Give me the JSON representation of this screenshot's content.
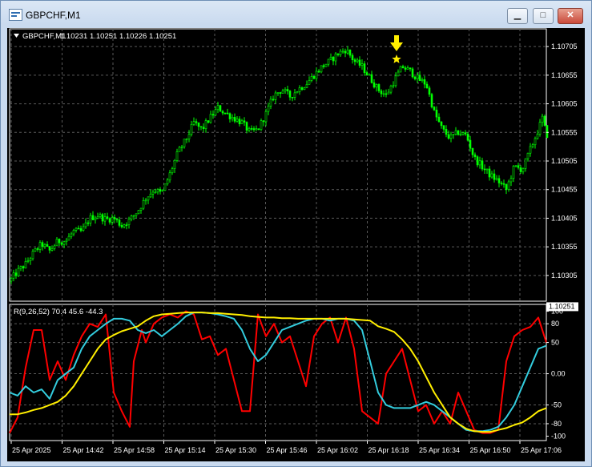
{
  "window": {
    "title": "GBPCHF,M1",
    "buttons": {
      "minimize": "▁",
      "maximize": "□",
      "close": "✕"
    }
  },
  "header": {
    "symbol": "GBPCHF,M1",
    "ohlc": "1.10231 1.10251 1.10226 1.10251",
    "menu_icon": "triangle-down-icon"
  },
  "indicator": {
    "label": "R(9,26,52) 70.4 45.6 -44.3"
  },
  "colors": {
    "background": "#000000",
    "candle": "#00ff00",
    "grid": "#5a5a5a",
    "axis_text": "#ffffff",
    "line_fast": "#ff0000",
    "line_mid": "#33ccdd",
    "line_slow": "#ffee00",
    "marker": "#ffee00"
  },
  "chart_data": [
    {
      "type": "candlestick",
      "symbol": "GBPCHF",
      "timeframe": "M1",
      "last_price": 1.10251,
      "last_price_label": "1.10251",
      "ylim": [
        1.1026,
        1.10736
      ],
      "y_ticks": [
        "1.10705",
        "1.10655",
        "1.10605",
        "1.10555",
        "1.10505",
        "1.10455",
        "1.10405",
        "1.10355",
        "1.10305"
      ],
      "x_ticks": [
        "25 Apr 2025",
        "25 Apr 14:42",
        "25 Apr 14:58",
        "25 Apr 15:14",
        "25 Apr 15:30",
        "25 Apr 15:46",
        "25 Apr 16:02",
        "25 Apr 16:18",
        "25 Apr 16:34",
        "25 Apr 16:50",
        "25 Apr 17:06"
      ],
      "close_path": [
        [
          0,
          1.10295
        ],
        [
          10,
          1.10312
        ],
        [
          20,
          1.10325
        ],
        [
          30,
          1.10345
        ],
        [
          40,
          1.1036
        ],
        [
          50,
          1.10348
        ],
        [
          60,
          1.10365
        ],
        [
          70,
          1.10365
        ],
        [
          80,
          1.10382
        ],
        [
          90,
          1.10382
        ],
        [
          100,
          1.10405
        ],
        [
          110,
          1.1041
        ],
        [
          120,
          1.10403
        ],
        [
          130,
          1.10405
        ],
        [
          140,
          1.10392
        ],
        [
          150,
          1.10402
        ],
        [
          160,
          1.10418
        ],
        [
          170,
          1.1044
        ],
        [
          180,
          1.10455
        ],
        [
          190,
          1.10448
        ],
        [
          200,
          1.10482
        ],
        [
          210,
          1.1052
        ],
        [
          220,
          1.10542
        ],
        [
          230,
          1.10572
        ],
        [
          240,
          1.1056
        ],
        [
          250,
          1.1058
        ],
        [
          260,
          1.10598
        ],
        [
          270,
          1.10588
        ],
        [
          280,
          1.1058
        ],
        [
          290,
          1.10572
        ],
        [
          300,
          1.10555
        ],
        [
          310,
          1.1056
        ],
        [
          320,
          1.10588
        ],
        [
          330,
          1.1062
        ],
        [
          340,
          1.1063
        ],
        [
          350,
          1.10618
        ],
        [
          360,
          1.1063
        ],
        [
          370,
          1.1064
        ],
        [
          380,
          1.10655
        ],
        [
          390,
          1.1067
        ],
        [
          400,
          1.1068
        ],
        [
          410,
          1.10693
        ],
        [
          420,
          1.107
        ],
        [
          430,
          1.1068
        ],
        [
          440,
          1.1067
        ],
        [
          450,
          1.1065
        ],
        [
          460,
          1.1063
        ],
        [
          470,
          1.1062
        ],
        [
          480,
          1.10645
        ],
        [
          490,
          1.1067
        ],
        [
          500,
          1.10662
        ],
        [
          510,
          1.10648
        ],
        [
          520,
          1.1064
        ],
        [
          530,
          1.1059
        ],
        [
          540,
          1.1056
        ],
        [
          550,
          1.10545
        ],
        [
          560,
          1.10555
        ],
        [
          570,
          1.1055
        ],
        [
          580,
          1.1051
        ],
        [
          590,
          1.10495
        ],
        [
          600,
          1.1048
        ],
        [
          610,
          1.1047
        ],
        [
          620,
          1.10455
        ],
        [
          630,
          1.10495
        ],
        [
          640,
          1.1049
        ],
        [
          650,
          1.10525
        ],
        [
          660,
          1.1056
        ],
        [
          665,
          1.1058
        ],
        [
          670,
          1.10551
        ]
      ],
      "annotations": [
        {
          "type": "arrow-down",
          "at": 483
        },
        {
          "type": "star",
          "at": 483
        }
      ]
    },
    {
      "type": "line",
      "name": "R(9,26,52)",
      "values_printed": [
        70.4,
        45.6,
        -44.3
      ],
      "ylim": [
        -107,
        111
      ],
      "y_ticks": [
        100,
        80,
        50,
        "0.00",
        -50,
        -80,
        -100
      ],
      "series": [
        {
          "color": "#ff0000",
          "values": [
            [
              0,
              -95
            ],
            [
              10,
              -70
            ],
            [
              20,
              10
            ],
            [
              30,
              70
            ],
            [
              40,
              70
            ],
            [
              50,
              -10
            ],
            [
              60,
              20
            ],
            [
              70,
              -10
            ],
            [
              80,
              30
            ],
            [
              90,
              60
            ],
            [
              100,
              80
            ],
            [
              110,
              75
            ],
            [
              120,
              95
            ],
            [
              130,
              -30
            ],
            [
              140,
              -60
            ],
            [
              150,
              -85
            ],
            [
              155,
              20
            ],
            [
              165,
              70
            ],
            [
              170,
              50
            ],
            [
              180,
              80
            ],
            [
              190,
              90
            ],
            [
              200,
              95
            ],
            [
              210,
              90
            ],
            [
              220,
              100
            ],
            [
              230,
              95
            ],
            [
              240,
              55
            ],
            [
              250,
              60
            ],
            [
              260,
              30
            ],
            [
              270,
              40
            ],
            [
              280,
              -10
            ],
            [
              290,
              -60
            ],
            [
              300,
              -60
            ],
            [
              310,
              95
            ],
            [
              320,
              60
            ],
            [
              330,
              80
            ],
            [
              340,
              50
            ],
            [
              350,
              60
            ],
            [
              360,
              20
            ],
            [
              370,
              -20
            ],
            [
              380,
              60
            ],
            [
              390,
              80
            ],
            [
              400,
              90
            ],
            [
              410,
              50
            ],
            [
              420,
              90
            ],
            [
              430,
              40
            ],
            [
              440,
              -60
            ],
            [
              450,
              -70
            ],
            [
              460,
              -80
            ],
            [
              470,
              0
            ],
            [
              480,
              20
            ],
            [
              490,
              40
            ],
            [
              500,
              -10
            ],
            [
              510,
              -60
            ],
            [
              520,
              -50
            ],
            [
              530,
              -80
            ],
            [
              540,
              -60
            ],
            [
              550,
              -80
            ],
            [
              560,
              -30
            ],
            [
              570,
              -60
            ],
            [
              580,
              -90
            ],
            [
              590,
              -95
            ],
            [
              600,
              -95
            ],
            [
              610,
              -90
            ],
            [
              620,
              20
            ],
            [
              630,
              60
            ],
            [
              640,
              70
            ],
            [
              650,
              75
            ],
            [
              660,
              90
            ],
            [
              670,
              50
            ]
          ]
        },
        {
          "color": "#33ccdd",
          "values": [
            [
              0,
              -30
            ],
            [
              10,
              -35
            ],
            [
              20,
              -20
            ],
            [
              30,
              -30
            ],
            [
              40,
              -25
            ],
            [
              50,
              -40
            ],
            [
              60,
              -10
            ],
            [
              70,
              0
            ],
            [
              80,
              10
            ],
            [
              90,
              40
            ],
            [
              100,
              60
            ],
            [
              110,
              70
            ],
            [
              120,
              80
            ],
            [
              130,
              88
            ],
            [
              140,
              88
            ],
            [
              150,
              85
            ],
            [
              160,
              70
            ],
            [
              170,
              65
            ],
            [
              180,
              70
            ],
            [
              190,
              60
            ],
            [
              200,
              70
            ],
            [
              210,
              80
            ],
            [
              220,
              92
            ],
            [
              230,
              98
            ],
            [
              240,
              98
            ],
            [
              250,
              97
            ],
            [
              260,
              95
            ],
            [
              270,
              92
            ],
            [
              280,
              88
            ],
            [
              290,
              70
            ],
            [
              300,
              40
            ],
            [
              310,
              20
            ],
            [
              320,
              30
            ],
            [
              330,
              50
            ],
            [
              340,
              70
            ],
            [
              350,
              75
            ],
            [
              360,
              80
            ],
            [
              370,
              85
            ],
            [
              380,
              88
            ],
            [
              390,
              88
            ],
            [
              400,
              85
            ],
            [
              410,
              88
            ],
            [
              420,
              88
            ],
            [
              430,
              85
            ],
            [
              440,
              70
            ],
            [
              450,
              20
            ],
            [
              460,
              -30
            ],
            [
              470,
              -50
            ],
            [
              480,
              -55
            ],
            [
              490,
              -55
            ],
            [
              500,
              -55
            ],
            [
              510,
              -50
            ],
            [
              520,
              -45
            ],
            [
              530,
              -50
            ],
            [
              540,
              -60
            ],
            [
              550,
              -70
            ],
            [
              560,
              -80
            ],
            [
              570,
              -90
            ],
            [
              580,
              -92
            ],
            [
              590,
              -92
            ],
            [
              600,
              -90
            ],
            [
              610,
              -85
            ],
            [
              620,
              -70
            ],
            [
              630,
              -50
            ],
            [
              640,
              -20
            ],
            [
              650,
              10
            ],
            [
              660,
              40
            ],
            [
              670,
              45
            ]
          ]
        },
        {
          "color": "#ffee00",
          "values": [
            [
              0,
              -65
            ],
            [
              10,
              -65
            ],
            [
              20,
              -62
            ],
            [
              30,
              -58
            ],
            [
              40,
              -55
            ],
            [
              50,
              -50
            ],
            [
              60,
              -45
            ],
            [
              70,
              -35
            ],
            [
              80,
              -20
            ],
            [
              90,
              0
            ],
            [
              100,
              20
            ],
            [
              110,
              40
            ],
            [
              120,
              55
            ],
            [
              130,
              62
            ],
            [
              140,
              68
            ],
            [
              150,
              72
            ],
            [
              160,
              76
            ],
            [
              170,
              85
            ],
            [
              180,
              92
            ],
            [
              190,
              95
            ],
            [
              200,
              96
            ],
            [
              210,
              97
            ],
            [
              220,
              98
            ],
            [
              230,
              98
            ],
            [
              240,
              98
            ],
            [
              250,
              97
            ],
            [
              260,
              97
            ],
            [
              270,
              96
            ],
            [
              280,
              95
            ],
            [
              290,
              94
            ],
            [
              300,
              92
            ],
            [
              310,
              91
            ],
            [
              320,
              90
            ],
            [
              330,
              90
            ],
            [
              340,
              89
            ],
            [
              350,
              89
            ],
            [
              360,
              88
            ],
            [
              370,
              88
            ],
            [
              380,
              88
            ],
            [
              390,
              88
            ],
            [
              400,
              88
            ],
            [
              410,
              88
            ],
            [
              420,
              88
            ],
            [
              430,
              87
            ],
            [
              440,
              86
            ],
            [
              450,
              85
            ],
            [
              460,
              76
            ],
            [
              470,
              72
            ],
            [
              480,
              67
            ],
            [
              490,
              55
            ],
            [
              500,
              40
            ],
            [
              510,
              20
            ],
            [
              520,
              -5
            ],
            [
              530,
              -30
            ],
            [
              540,
              -50
            ],
            [
              550,
              -70
            ],
            [
              560,
              -80
            ],
            [
              570,
              -88
            ],
            [
              580,
              -92
            ],
            [
              590,
              -93
            ],
            [
              600,
              -93
            ],
            [
              610,
              -90
            ],
            [
              620,
              -87
            ],
            [
              630,
              -82
            ],
            [
              640,
              -78
            ],
            [
              650,
              -70
            ],
            [
              660,
              -60
            ],
            [
              670,
              -55
            ]
          ]
        }
      ]
    }
  ]
}
